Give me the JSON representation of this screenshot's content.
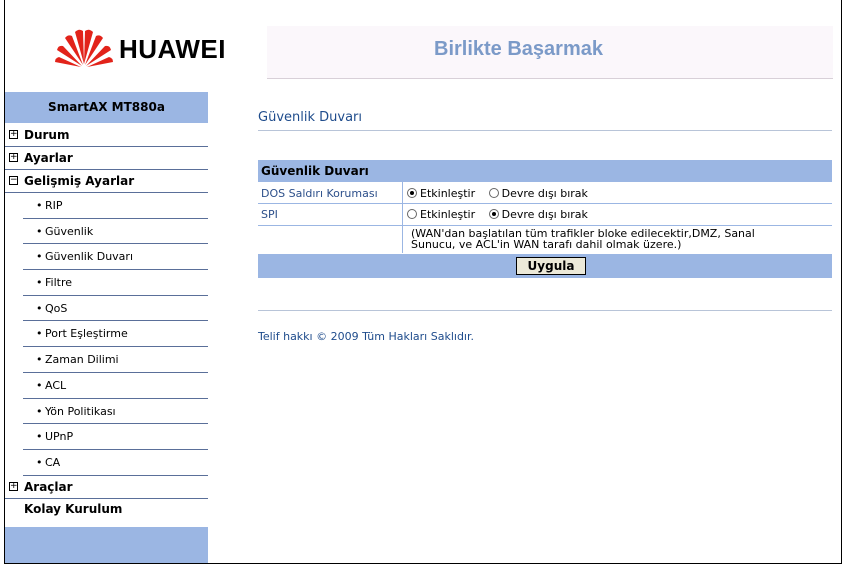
{
  "header": {
    "logo_text": "HUAWEI",
    "slogan": "Birlikte Başarmak",
    "brand_color": "#e2231a",
    "slogan_color": "#7b9ac8"
  },
  "sidebar": {
    "title": "SmartAX MT880a",
    "top_items": [
      {
        "label": "Durum",
        "expander": "+"
      },
      {
        "label": "Ayarlar",
        "expander": "+"
      },
      {
        "label": "Gelişmiş Ayarlar",
        "expander": "−"
      }
    ],
    "sub_items": [
      {
        "label": "RIP"
      },
      {
        "label": "Güvenlik"
      },
      {
        "label": "Güvenlik Duvarı"
      },
      {
        "label": "Filtre"
      },
      {
        "label": "QoS"
      },
      {
        "label": "Port Eşleştirme"
      },
      {
        "label": "Zaman Dilimi"
      },
      {
        "label": "ACL"
      },
      {
        "label": "Yön Politikası"
      },
      {
        "label": "UPnP"
      },
      {
        "label": "CA"
      }
    ],
    "tools": {
      "label": "Araçlar",
      "expander": "+"
    },
    "quick_setup": "Kolay Kurulum",
    "bullet": "•"
  },
  "main": {
    "title": "Güvenlik Duvarı",
    "table_header": "Güvenlik Duvarı",
    "rows": [
      {
        "label": "DOS Saldırı Koruması",
        "enable_label": "Etkinleştir",
        "disable_label": "Devre dışı bırak",
        "selected": "enable"
      },
      {
        "label": "SPI",
        "enable_label": "Etkinleştir",
        "disable_label": "Devre dışı bırak",
        "selected": "disable"
      }
    ],
    "note_line1": "(WAN'dan başlatılan tüm trafikler bloke edilecektir,DMZ, Sanal",
    "note_line2": "Sunucu, ve ACL'in WAN tarafı dahil olmak üzere.)",
    "apply_label": "Uygula",
    "accent_color": "#9bb6e3"
  },
  "footer": {
    "copyright": "Telif hakkı © 2009 Tüm Hakları Saklıdır."
  }
}
